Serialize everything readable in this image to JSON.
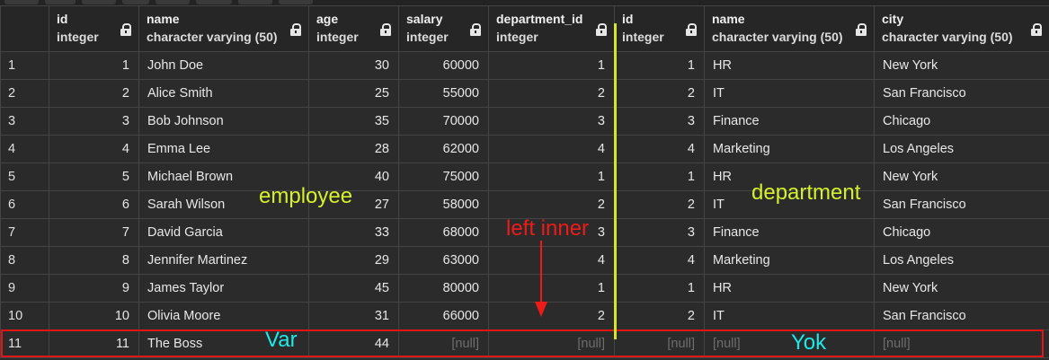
{
  "columns": [
    {
      "name": "id",
      "type": "integer"
    },
    {
      "name": "name",
      "type": "character varying (50)"
    },
    {
      "name": "age",
      "type": "integer"
    },
    {
      "name": "salary",
      "type": "integer"
    },
    {
      "name": "department_id",
      "type": "integer"
    },
    {
      "name": "id",
      "type": "integer"
    },
    {
      "name": "name",
      "type": "character varying (50)"
    },
    {
      "name": "city",
      "type": "character varying (50)"
    }
  ],
  "rows": [
    [
      "1",
      "1",
      "John Doe",
      "30",
      "60000",
      "1",
      "1",
      "HR",
      "New York"
    ],
    [
      "2",
      "2",
      "Alice Smith",
      "25",
      "55000",
      "2",
      "2",
      "IT",
      "San Francisco"
    ],
    [
      "3",
      "3",
      "Bob Johnson",
      "35",
      "70000",
      "3",
      "3",
      "Finance",
      "Chicago"
    ],
    [
      "4",
      "4",
      "Emma Lee",
      "28",
      "62000",
      "4",
      "4",
      "Marketing",
      "Los Angeles"
    ],
    [
      "5",
      "5",
      "Michael Brown",
      "40",
      "75000",
      "1",
      "1",
      "HR",
      "New York"
    ],
    [
      "6",
      "6",
      "Sarah Wilson",
      "27",
      "58000",
      "2",
      "2",
      "IT",
      "San Francisco"
    ],
    [
      "7",
      "7",
      "David Garcia",
      "33",
      "68000",
      "3",
      "3",
      "Finance",
      "Chicago"
    ],
    [
      "8",
      "8",
      "Jennifer Martinez",
      "29",
      "63000",
      "4",
      "4",
      "Marketing",
      "Los Angeles"
    ],
    [
      "9",
      "9",
      "James Taylor",
      "45",
      "80000",
      "1",
      "1",
      "HR",
      "New York"
    ],
    [
      "10",
      "10",
      "Olivia Moore",
      "31",
      "66000",
      "2",
      "2",
      "IT",
      "San Francisco"
    ],
    [
      "11",
      "11",
      "The Boss",
      "44",
      "[null]",
      "[null]",
      "[null]",
      "[null]",
      "[null]"
    ]
  ],
  "annotations": {
    "employee": "employee",
    "department": "department",
    "left_inner": "left inner",
    "var": "Var",
    "yok": "Yok"
  },
  "colors": {
    "background": "#2b2b2b",
    "grid_line": "#444444",
    "null_text": "#6e6e6e",
    "highlight_box": "#e01515",
    "divider_line": "#d4e62a",
    "label_yellow": "#d6f02c",
    "label_red": "#ee1b1b",
    "label_cyan": "#1ee8e8"
  },
  "icons": {
    "header_column": "lock-icon"
  }
}
